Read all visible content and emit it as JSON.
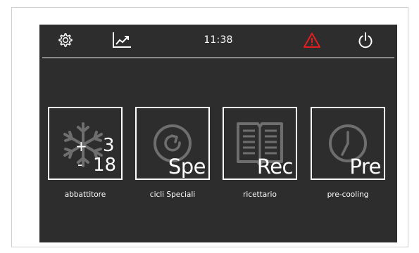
{
  "status_bar": {
    "time": "11:38",
    "icons": [
      "gear-icon",
      "trend-chart-icon",
      "warning-icon",
      "power-icon"
    ],
    "warning_color": "#e41e1e"
  },
  "tiles": [
    {
      "id": "abbattitore",
      "label": "abbattitore",
      "icon": "snowflake-icon",
      "plus_sign": "+",
      "minus_sign": "-",
      "value_plus": "3",
      "value_minus": "18"
    },
    {
      "id": "cicli-speciali",
      "label": "cicli Speciali",
      "icon": "cycle-icon",
      "badge": "Spe"
    },
    {
      "id": "ricettario",
      "label": "ricettario",
      "icon": "book-icon",
      "badge": "Rec"
    },
    {
      "id": "pre-cooling",
      "label": "pre-cooling",
      "icon": "clock-icon",
      "badge": "Pre"
    }
  ],
  "colors": {
    "screen_bg": "#2d2d2d",
    "foreground": "#ffffff",
    "icon_faded": "#6e6e6e",
    "divider": "#8a8a8a"
  }
}
